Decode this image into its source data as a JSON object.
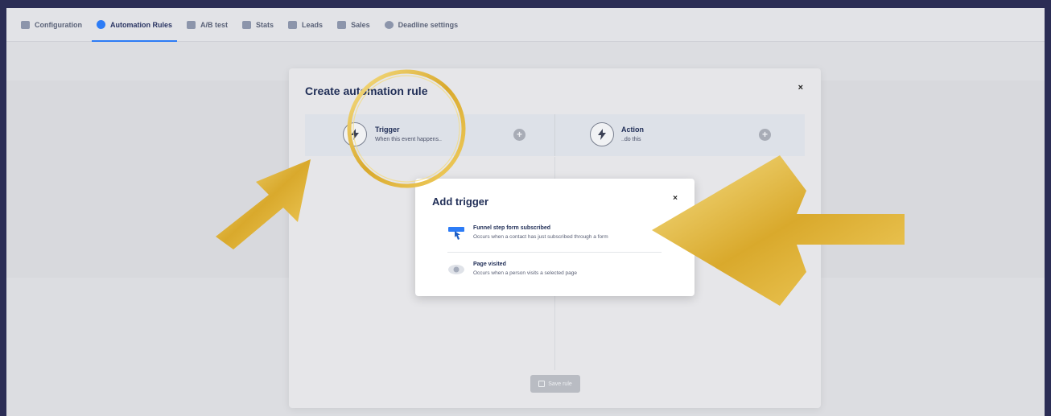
{
  "nav": {
    "tabs": [
      {
        "label": "Configuration",
        "icon": "config-icon"
      },
      {
        "label": "Automation Rules",
        "icon": "automation-icon",
        "active": true
      },
      {
        "label": "A/B test",
        "icon": "ab-test-icon"
      },
      {
        "label": "Stats",
        "icon": "stats-icon"
      },
      {
        "label": "Leads",
        "icon": "leads-icon"
      },
      {
        "label": "Sales",
        "icon": "sales-icon"
      },
      {
        "label": "Deadline settings",
        "icon": "clock-icon"
      }
    ]
  },
  "dialog": {
    "title": "Create automation rule",
    "close": "×",
    "trigger": {
      "title": "Trigger",
      "subtitle": "When this event happens.."
    },
    "action": {
      "title": "Action",
      "subtitle": "..do this"
    },
    "save_label": "Save rule"
  },
  "popup": {
    "title": "Add trigger",
    "close": "×",
    "options": [
      {
        "title": "Funnel step form subscribed",
        "desc": "Occurs when a contact has just subscribed through a form",
        "icon": "form-click-icon"
      },
      {
        "title": "Page visited",
        "desc": "Occurs when a person visits a selected page",
        "icon": "eye-icon"
      }
    ]
  },
  "colors": {
    "accent": "#2d7cf6",
    "highlight_gold": "#e0b93a",
    "title_navy": "#1f2d56"
  }
}
